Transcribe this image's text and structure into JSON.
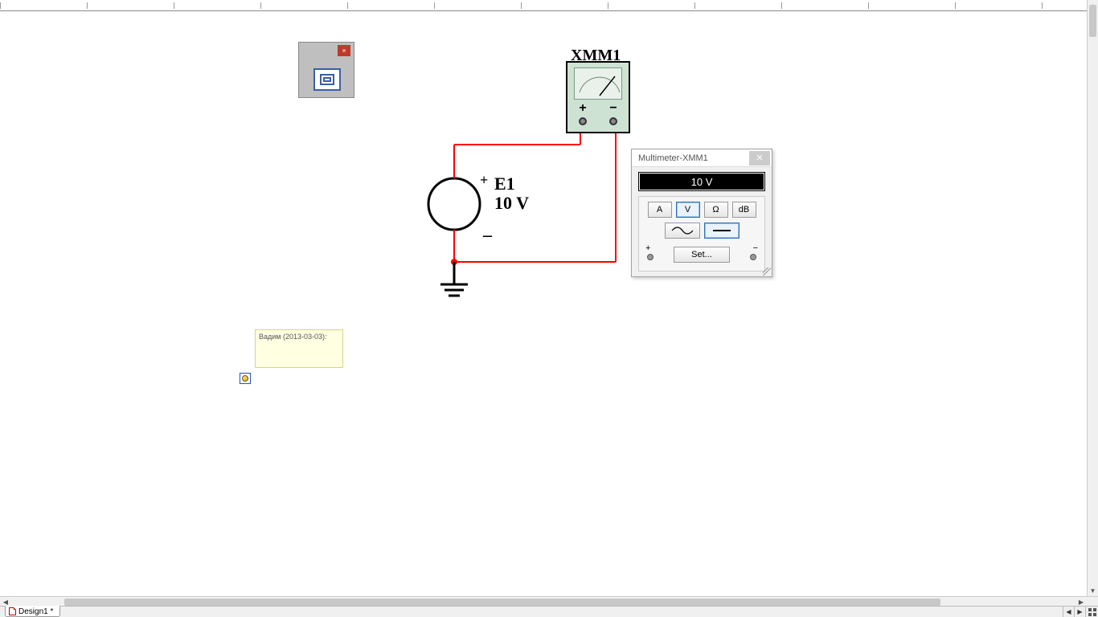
{
  "tab": {
    "label": "Design1 *"
  },
  "instrument": {
    "label": "XMM1",
    "plus": "+",
    "minus": "−"
  },
  "source": {
    "name": "E1",
    "value": "10 V",
    "plus": "+",
    "minus": "_"
  },
  "multimeter_dialog": {
    "title": "Multimeter-XMM1",
    "reading": "10 V",
    "buttons": {
      "amp": "A",
      "volt": "V",
      "ohm": "Ω",
      "db": "dB"
    },
    "set": "Set...",
    "term_plus": "+",
    "term_minus": "−"
  },
  "note": {
    "text": "Вадим (2013-03-03):"
  },
  "palette": {
    "close": "×"
  }
}
